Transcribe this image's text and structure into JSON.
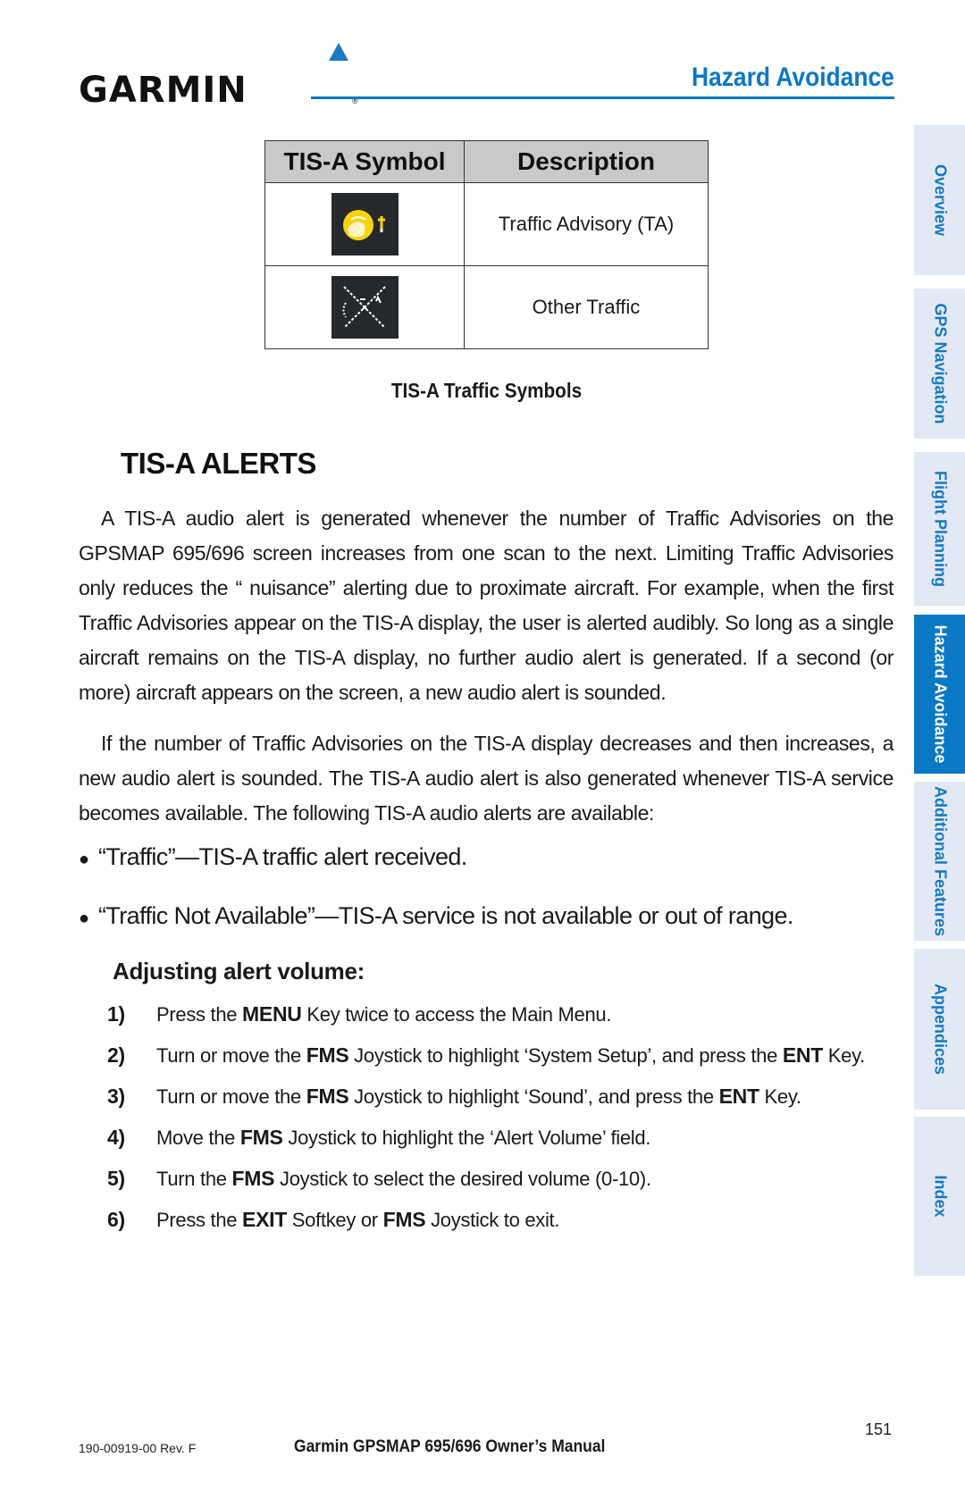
{
  "header": {
    "brand": "GARMIN",
    "registered_mark": "®",
    "section_title": "Hazard Avoidance"
  },
  "symbol_table": {
    "headers": [
      "TIS-A Symbol",
      "Description"
    ],
    "rows": [
      {
        "icon": "traffic-advisory-symbol",
        "description": "Traffic Advisory (TA)"
      },
      {
        "icon": "other-traffic-symbol",
        "description": "Other Traffic"
      }
    ],
    "caption": "TIS-A Traffic Symbols"
  },
  "main": {
    "heading": "TIS-A ALERTS",
    "paragraphs": [
      "A TIS-A audio alert is generated whenever the number of Traffic Advisories on the GPSMAP 695/696 screen increases from one scan to the next. Limiting Traffic Advisories only reduces the “ nuisance” alerting due to proximate aircraft. For example, when the first Traffic Advisories appear on the TIS-A display, the user is alerted audibly. So long as a single aircraft remains on the TIS-A display, no further audio alert is generated. If a second (or more) aircraft appears on the screen, a new audio alert is sounded.",
      "If the number of Traffic Advisories on the TIS-A display decreases and then increases, a new audio alert is sounded. The TIS-A audio alert is also generated whenever TIS-A service becomes available. The following TIS-A audio alerts are available:"
    ],
    "bullets": [
      "“Traffic”—TIS-A traffic alert received.",
      "“Traffic Not Available”—TIS-A service is not available or out of range."
    ],
    "procedure_title": "Adjusting alert volume:",
    "steps": [
      {
        "num": "1)",
        "parts": [
          {
            "t": "Press the "
          },
          {
            "b": "MENU"
          },
          {
            "t": " Key twice to access the Main Menu."
          }
        ]
      },
      {
        "num": "2)",
        "parts": [
          {
            "t": "Turn or move the "
          },
          {
            "b": "FMS"
          },
          {
            "t": " Joystick to highlight ‘System Setup’, and press the "
          },
          {
            "b": "ENT"
          },
          {
            "t": " Key."
          }
        ]
      },
      {
        "num": "3)",
        "parts": [
          {
            "t": "Turn or move the "
          },
          {
            "b": "FMS"
          },
          {
            "t": " Joystick to highlight ‘Sound’, and press the "
          },
          {
            "b": "ENT"
          },
          {
            "t": " Key."
          }
        ]
      },
      {
        "num": "4)",
        "parts": [
          {
            "t": "Move the "
          },
          {
            "b": "FMS"
          },
          {
            "t": " Joystick to highlight the ‘Alert Volume’ field."
          }
        ]
      },
      {
        "num": "5)",
        "parts": [
          {
            "t": "Turn the "
          },
          {
            "b": "FMS"
          },
          {
            "t": " Joystick to select the desired volume (0-10)."
          }
        ]
      },
      {
        "num": "6)",
        "parts": [
          {
            "t": "Press the "
          },
          {
            "b": "EXIT"
          },
          {
            "t": " Softkey or "
          },
          {
            "b": "FMS"
          },
          {
            "t": " Joystick to exit."
          }
        ]
      }
    ]
  },
  "side_tabs": [
    {
      "label": "Overview",
      "active": false
    },
    {
      "label": "GPS Navigation",
      "active": false
    },
    {
      "label": "Flight Planning",
      "active": false
    },
    {
      "label": "Hazard Avoidance",
      "active": true
    },
    {
      "label": "Additional Features",
      "active": false
    },
    {
      "label": "Appendices",
      "active": false
    },
    {
      "label": "Index",
      "active": false
    }
  ],
  "footer": {
    "doc_number": "190-00919-00 Rev. F",
    "manual_title": "Garmin GPSMAP 695/696 Owner’s Manual",
    "page_number": "151"
  },
  "colors": {
    "brand_blue": "#0b78c5",
    "tab_inactive_bg": "#e3e8f5",
    "table_header_bg": "#c8c9cb",
    "symbol_bg": "#26292c",
    "ta_symbol_yellow": "#f5d40f"
  }
}
